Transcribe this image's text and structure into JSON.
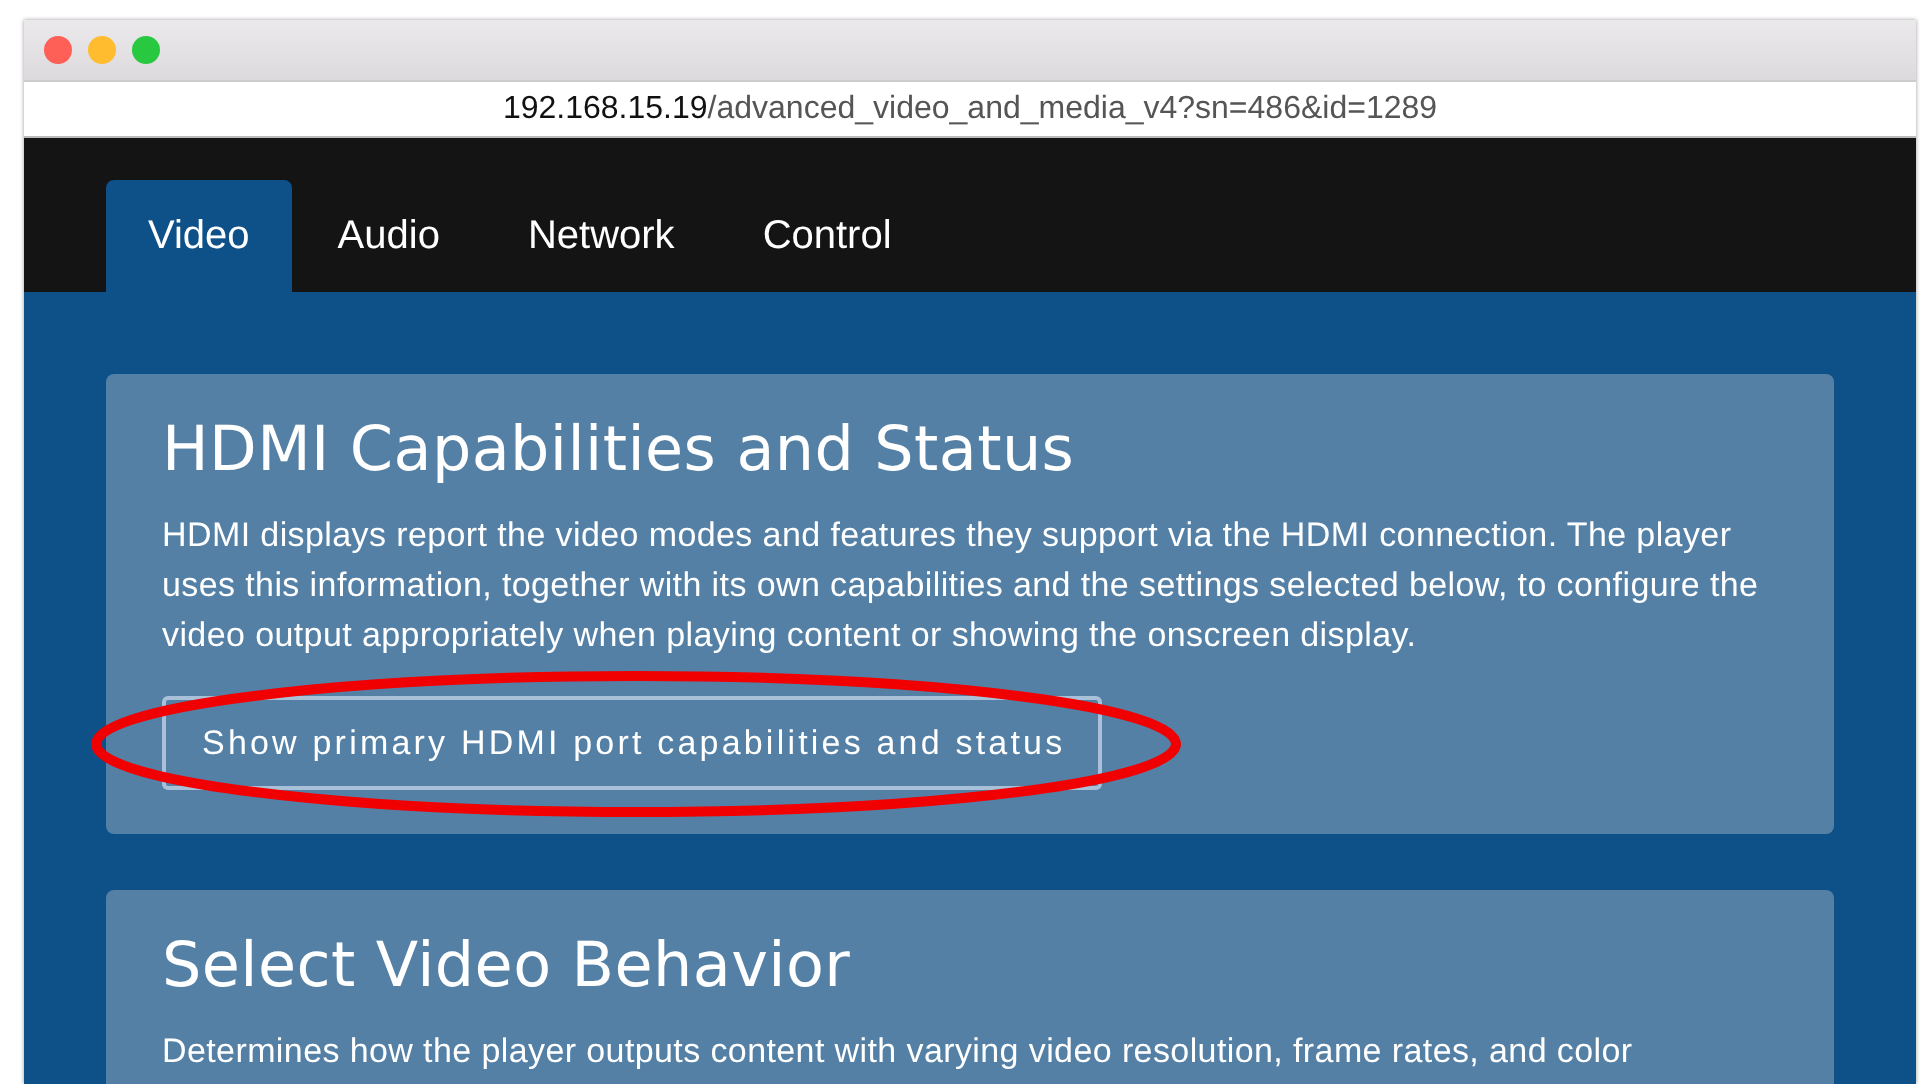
{
  "browser": {
    "url_host": "192.168.15.19",
    "url_path": "/advanced_video_and_media_v4?sn=486&id=1289"
  },
  "tabs": [
    {
      "label": "Video",
      "selected": true
    },
    {
      "label": "Audio",
      "selected": false
    },
    {
      "label": "Network",
      "selected": false
    },
    {
      "label": "Control",
      "selected": false
    }
  ],
  "sections": [
    {
      "title": "HDMI Capabilities and Status",
      "text": "HDMI displays report the video modes and features they support via the HDMI connection. The player uses this information, together with its own capabilities and the settings selected below, to configure the video output appropriately when playing content or showing the onscreen display.",
      "button": "Show primary HDMI port capabilities and status",
      "annotation": {
        "kind": "ellipse"
      }
    },
    {
      "title": "Select Video Behavior",
      "text": "Determines how the player outputs content with varying video resolution, frame rates, and color"
    }
  ]
}
